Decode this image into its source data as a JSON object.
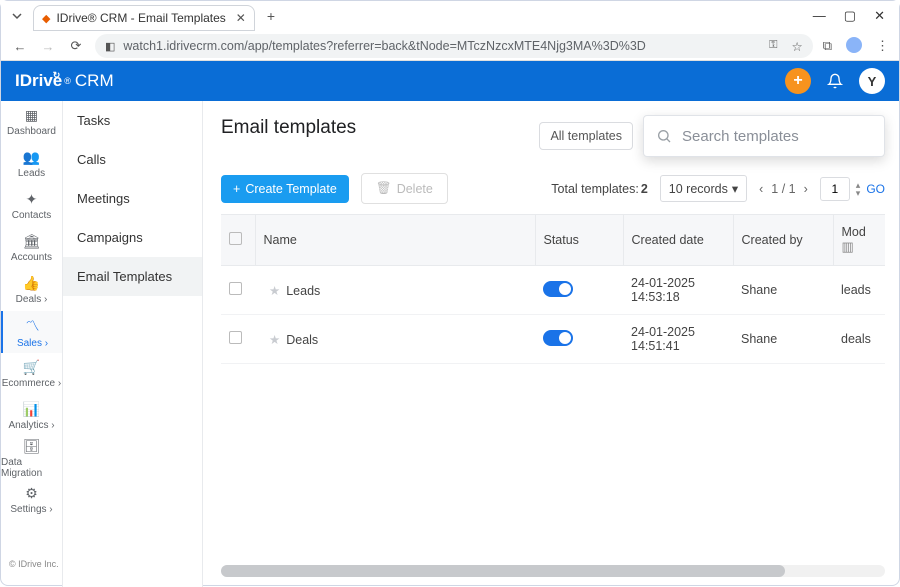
{
  "browser": {
    "tab_title": "IDrive® CRM - Email Templates",
    "url": "watch1.idrivecrm.com/app/templates?referrer=back&tNode=MTczNzcxMTE4Njg3MA%3D%3D"
  },
  "header": {
    "logo_text": "IDrive® CRM",
    "avatar_initial": "Y"
  },
  "sidebar_main": [
    {
      "label": "Dashboard"
    },
    {
      "label": "Leads"
    },
    {
      "label": "Contacts"
    },
    {
      "label": "Accounts"
    },
    {
      "label": "Deals ›"
    },
    {
      "label": "Sales ›",
      "active": true
    },
    {
      "label": "Ecommerce ›"
    },
    {
      "label": "Analytics ›"
    },
    {
      "label": "Data Migration"
    },
    {
      "label": "Settings ›"
    }
  ],
  "sidebar_sub": [
    {
      "label": "Tasks"
    },
    {
      "label": "Calls"
    },
    {
      "label": "Meetings"
    },
    {
      "label": "Campaigns"
    },
    {
      "label": "Email Templates",
      "active": true
    }
  ],
  "page": {
    "title": "Email templates",
    "filter_label": "All templates",
    "search_placeholder": "Search templates",
    "create_btn": "Create Template",
    "delete_btn": "Delete",
    "total_label": "Total templates:",
    "total_value": "2",
    "records_label": "10 records",
    "page_indicator": "1 / 1",
    "goto_value": "1",
    "go_label": "GO"
  },
  "table": {
    "columns": [
      "Name",
      "Status",
      "Created date",
      "Created by",
      "Mod"
    ],
    "rows": [
      {
        "name": "Leads",
        "status": "on",
        "created": "24-01-2025 14:53:18",
        "by": "Shane",
        "module": "leads"
      },
      {
        "name": "Deals",
        "status": "on",
        "created": "24-01-2025 14:51:41",
        "by": "Shane",
        "module": "deals"
      }
    ]
  },
  "footer": {
    "copyright": "© IDrive Inc."
  }
}
